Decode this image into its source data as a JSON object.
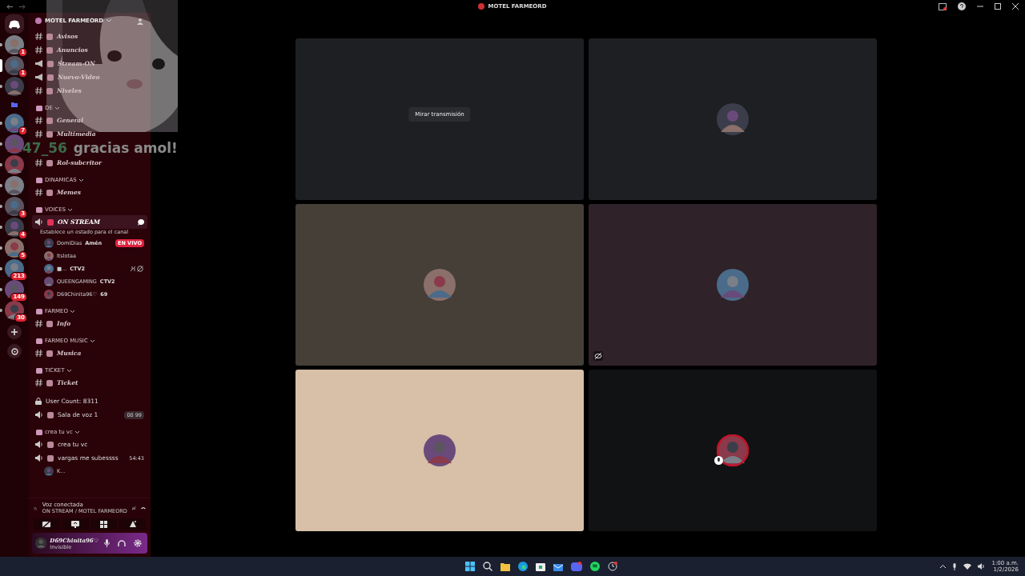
{
  "window": {
    "title": "MOTEL FARMEORD"
  },
  "servers": [
    {
      "badge": "1",
      "selected": false
    },
    {
      "badge": "1",
      "selected": true
    },
    {
      "selected": false
    },
    {
      "kind": "folder",
      "selected": false
    },
    {
      "badge": "7",
      "selected": false
    },
    {
      "selected": false
    },
    {
      "selected": false
    },
    {
      "selected": false
    },
    {
      "badge": "3",
      "selected": false
    },
    {
      "badge": "4",
      "selected": false
    },
    {
      "badge": "5",
      "selected": false
    },
    {
      "badge": "213",
      "selected": false
    },
    {
      "badge": "149",
      "selected": false
    },
    {
      "badge": "30",
      "selected": false
    }
  ],
  "server_name": "MOTEL FARMEORD",
  "sections": [
    {
      "channels": [
        {
          "kind": "text",
          "name": "Avisos"
        },
        {
          "kind": "text",
          "name": "Anuncios"
        },
        {
          "kind": "announcement",
          "name": "Stream-ON"
        },
        {
          "kind": "announcement",
          "name": "Nuevo-Video"
        },
        {
          "kind": "text",
          "name": "Niveles"
        }
      ]
    },
    {
      "category": "DE",
      "channels": [
        {
          "kind": "text",
          "name": "General"
        },
        {
          "kind": "text",
          "name": "Multimedia"
        },
        {
          "kind": "alert",
          "user": "47_56",
          "message": "gracias amol!"
        },
        {
          "kind": "text",
          "name": "Rol-subcritor"
        }
      ]
    },
    {
      "category": "DINAMICAS",
      "channels": [
        {
          "kind": "text",
          "name": "Memes"
        }
      ]
    },
    {
      "category": "VOICES",
      "channels": [
        {
          "kind": "voice",
          "name": "ON STREAM",
          "selected": true,
          "status": "Establece un estado para el canal",
          "users": [
            {
              "name": "DomiDias",
              "tag": "Amén",
              "live": "EN VIVO"
            },
            {
              "name": "ltslotaa"
            },
            {
              "name": "■...",
              "tag": "CTV2",
              "muted": true
            },
            {
              "name": "QUEENGAMING",
              "tag": "CTV2"
            },
            {
              "name": "D69Chinita96♡",
              "tag": "69"
            }
          ]
        }
      ]
    },
    {
      "category": "FARMEO",
      "channels": [
        {
          "kind": "text",
          "name": "Info"
        }
      ]
    },
    {
      "category": "FARMEO MUSIC",
      "channels": [
        {
          "kind": "text",
          "name": "Musica"
        }
      ]
    },
    {
      "category": "TICKET",
      "channels": [
        {
          "kind": "text",
          "name": "Ticket"
        }
      ]
    },
    {
      "channels": [
        {
          "kind": "lock",
          "name": "User Count: 8311"
        },
        {
          "kind": "voice",
          "name": "Sala de voz 1",
          "limit": "00  99"
        }
      ]
    },
    {
      "category": "crea tu vc",
      "channels": [
        {
          "kind": "voice",
          "name": "crea tu vc"
        },
        {
          "kind": "voice",
          "name": "vargas me subessss",
          "timer": "54:43",
          "users": [
            {
              "name": "K..."
            }
          ]
        }
      ]
    }
  ],
  "voice_panel": {
    "status": "Voz conectada",
    "channel": "ON STREAM / MOTEL FARMEORD"
  },
  "user_panel": {
    "name": "D69Chinita96♡",
    "status": "Invisible"
  },
  "tiles": [
    {
      "color": "#1e1f22",
      "button": "Mirar transmisión"
    },
    {
      "color": "#1e1f22",
      "avatar": true
    },
    {
      "color": "#453f37",
      "avatar": true
    },
    {
      "color": "#2f2228",
      "avatar": true,
      "hidden_icon": true
    },
    {
      "color": "#d7bfa8",
      "avatar": true
    },
    {
      "color": "#111214",
      "avatar": true,
      "muted": true
    }
  ],
  "taskbar": {
    "time": "1:00 a.m.",
    "date": "1/2/2026"
  }
}
